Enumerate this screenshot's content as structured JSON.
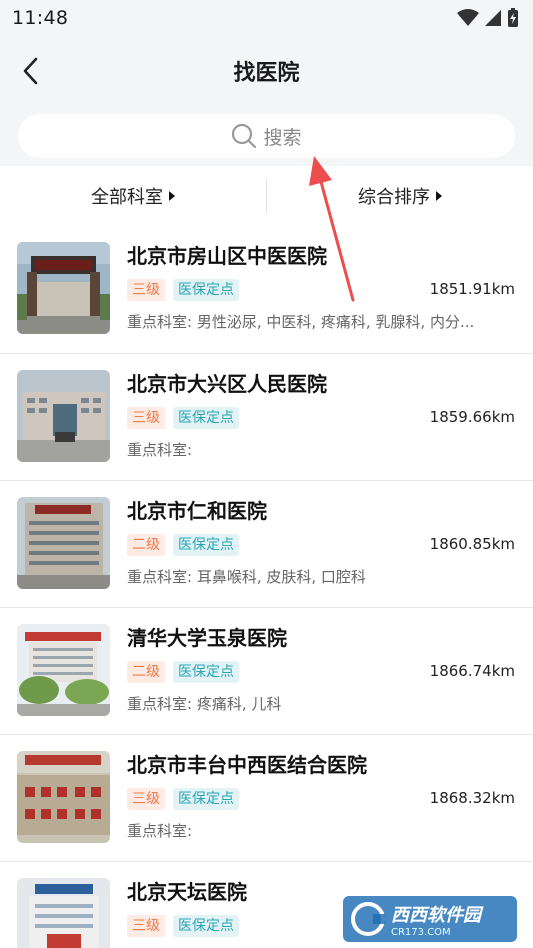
{
  "status": {
    "time": "11:48"
  },
  "header": {
    "title": "找医院"
  },
  "search": {
    "placeholder": "搜索"
  },
  "filters": [
    {
      "label": "全部科室"
    },
    {
      "label": "综合排序"
    }
  ],
  "hospitals": [
    {
      "name": "北京市房山区中医医院",
      "level": "三级",
      "insurance": "医保定点",
      "distance": "1851.91km",
      "departments": "重点科室: 男性泌尿, 中医科, 疼痛科, 乳腺科, 内分..."
    },
    {
      "name": "北京市大兴区人民医院",
      "level": "三级",
      "insurance": "医保定点",
      "distance": "1859.66km",
      "departments": "重点科室:"
    },
    {
      "name": "北京市仁和医院",
      "level": "二级",
      "insurance": "医保定点",
      "distance": "1860.85km",
      "departments": "重点科室: 耳鼻喉科, 皮肤科, 口腔科"
    },
    {
      "name": "清华大学玉泉医院",
      "level": "二级",
      "insurance": "医保定点",
      "distance": "1866.74km",
      "departments": "重点科室: 疼痛科, 儿科"
    },
    {
      "name": "北京市丰台中西医结合医院",
      "level": "三级",
      "insurance": "医保定点",
      "distance": "1868.32km",
      "departments": "重点科室:"
    },
    {
      "name": "北京天坛医院",
      "level": "三级",
      "insurance": "医保定点",
      "distance": "",
      "departments": ""
    }
  ],
  "watermark": {
    "brand": "西西软件园",
    "site": "CR173.COM"
  },
  "colors": {
    "level_tag": "#f07a4a",
    "insurance_tag": "#2aa6b6",
    "annotation_arrow": "#ee4d4d"
  }
}
